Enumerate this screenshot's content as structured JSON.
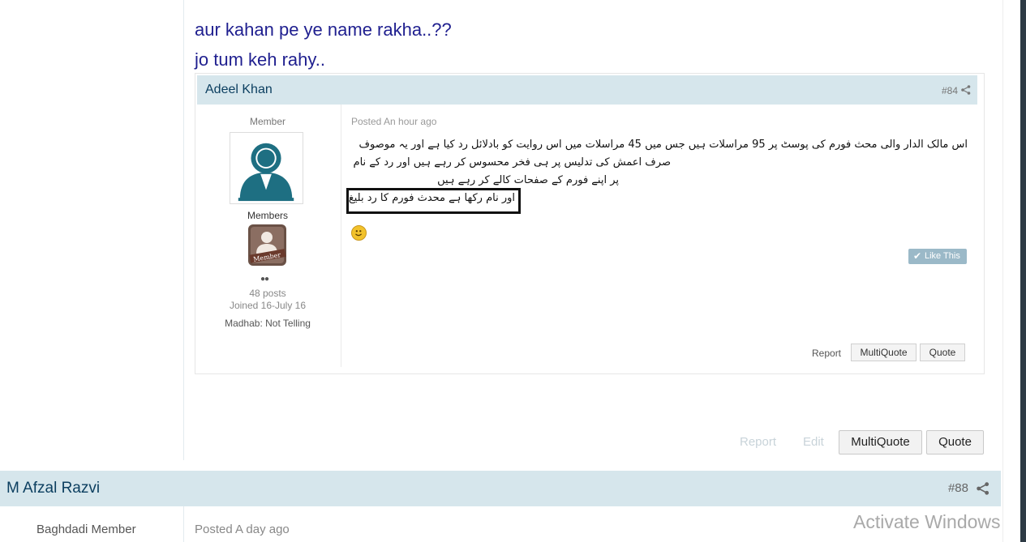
{
  "message": {
    "lines": [
      "aur kahan pe ye name rakha..??",
      "jo tum keh rahy.."
    ]
  },
  "embedded": {
    "author": "Adeel Khan",
    "post_number": "#84",
    "role_top": "Member",
    "group": "Members",
    "posts": "48 posts",
    "joined": "Joined 16-July 16",
    "madhab": "Madhab: Not Telling",
    "posted": "Posted An hour ago",
    "urdu_lines": [
      "اس مالک الدار والی محث فورم کی پوسٹ پر 95 مراسلات ہیں جس میں 45 مراسلات میں اس روایت کو بادلائل رد کیا ہے اور یہ موصوف",
      "صرف اعمش کی تدلیس پر ہی فخر محسوس کر رہے ہیں اور رد کے نام",
      "پر اپنے فورم کے صفحات کالے کر رہے ہیں",
      "اور نام رکھا ہے محدث فورم کا رد بلیغ"
    ],
    "like_label": "Like This",
    "report_label": "Report",
    "multiquote_label": "MultiQuote",
    "quote_label": "Quote"
  },
  "controls": {
    "report": "Report",
    "edit": "Edit",
    "multiquote": "MultiQuote",
    "quote": "Quote"
  },
  "post2": {
    "author": "M Afzal Razvi",
    "post_number": "#88",
    "role": "Baghdadi Member",
    "posted": "Posted A day ago"
  },
  "watermark": {
    "title": "Activate Windows"
  },
  "colors": {
    "header_bg": "#d6e6ec",
    "author_color": "#0c3f60",
    "message_color": "#1f1f8f"
  }
}
